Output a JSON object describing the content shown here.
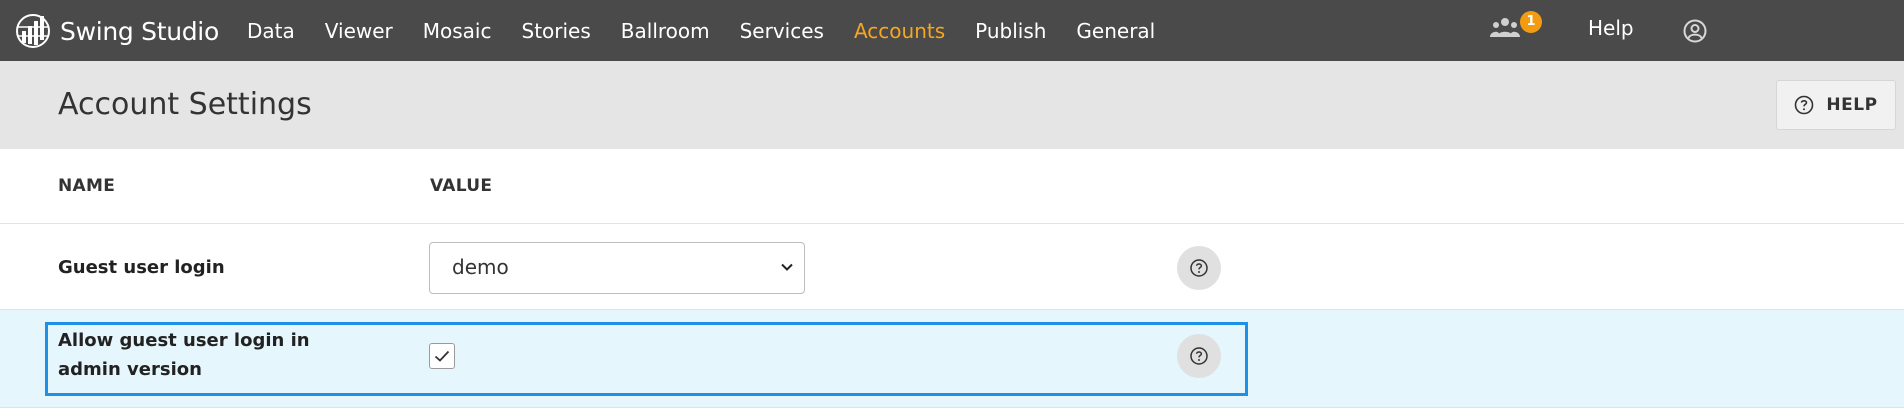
{
  "app": {
    "name": "Swing Studio"
  },
  "nav": {
    "items": [
      {
        "label": "Data"
      },
      {
        "label": "Viewer"
      },
      {
        "label": "Mosaic"
      },
      {
        "label": "Stories"
      },
      {
        "label": "Ballroom"
      },
      {
        "label": "Services"
      },
      {
        "label": "Accounts",
        "active": true
      },
      {
        "label": "Publish"
      },
      {
        "label": "General"
      }
    ],
    "users_badge": "1",
    "help": "Help"
  },
  "page": {
    "title": "Account Settings",
    "help_button": "HELP"
  },
  "table": {
    "headers": {
      "name": "NAME",
      "value": "VALUE"
    },
    "rows": [
      {
        "name": "Guest user login",
        "value": "demo",
        "type": "select"
      },
      {
        "name": "Allow guest user login in admin version",
        "value": "checked",
        "type": "checkbox"
      }
    ]
  },
  "colors": {
    "topbar": "#4a4a4a",
    "active_nav": "#f5a623",
    "badge": "#f39c12",
    "focus_border": "#1e90e8",
    "highlight_row": "#e6f6fd"
  },
  "icons": {
    "logo": "globe-bars-icon",
    "users": "users-icon",
    "profile": "user-circle-icon",
    "help": "question-circle-icon",
    "select_arrow": "chevron-down-icon",
    "check": "check-icon"
  }
}
